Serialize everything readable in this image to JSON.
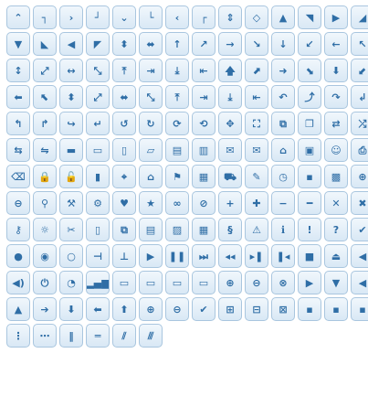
{
  "palette": {
    "tile_top": "#f1f7fc",
    "tile_bottom": "#d9e8f5",
    "border": "#a9c6df",
    "icon": "#2f6ea6"
  },
  "icons": [
    {
      "name": "caret-up-icon",
      "glyph": "⌃"
    },
    {
      "name": "corner-top-right-icon",
      "glyph": "┐"
    },
    {
      "name": "caret-right-icon",
      "glyph": "›"
    },
    {
      "name": "corner-bottom-right-icon",
      "glyph": "┘"
    },
    {
      "name": "caret-down-icon",
      "glyph": "⌄"
    },
    {
      "name": "corner-bottom-left-icon",
      "glyph": "└"
    },
    {
      "name": "caret-left-icon",
      "glyph": "‹"
    },
    {
      "name": "corner-top-left-icon",
      "glyph": "┌"
    },
    {
      "name": "caret-up-down-icon",
      "glyph": "⇕"
    },
    {
      "name": "caret-left-right-icon",
      "glyph": "◇"
    },
    {
      "name": "triangle-up-icon",
      "glyph": "▲"
    },
    {
      "name": "triangle-up-right-icon",
      "glyph": "◥"
    },
    {
      "name": "triangle-right-icon",
      "glyph": "▶"
    },
    {
      "name": "triangle-down-right-icon",
      "glyph": "◢"
    },
    {
      "name": "triangle-down-icon",
      "glyph": "▼"
    },
    {
      "name": "triangle-down-left-icon",
      "glyph": "◣"
    },
    {
      "name": "triangle-left-icon",
      "glyph": "◀"
    },
    {
      "name": "triangle-up-left-icon",
      "glyph": "◤"
    },
    {
      "name": "triangle-up-down-icon",
      "glyph": "⬍"
    },
    {
      "name": "triangle-left-right-icon",
      "glyph": "⬌"
    },
    {
      "name": "arrow-up-thin-icon",
      "glyph": "↑"
    },
    {
      "name": "arrow-up-right-thin-icon",
      "glyph": "↗"
    },
    {
      "name": "arrow-right-thin-icon",
      "glyph": "→"
    },
    {
      "name": "arrow-down-right-thin-icon",
      "glyph": "↘"
    },
    {
      "name": "arrow-down-thin-icon",
      "glyph": "↓"
    },
    {
      "name": "arrow-down-left-thin-icon",
      "glyph": "↙"
    },
    {
      "name": "arrow-left-thin-icon",
      "glyph": "←"
    },
    {
      "name": "arrow-up-left-thin-icon",
      "glyph": "↖"
    },
    {
      "name": "arrow-up-down-thin-icon",
      "glyph": "↕"
    },
    {
      "name": "arrow-diagonal-expand-thin-icon",
      "glyph": "⤢"
    },
    {
      "name": "arrow-left-right-thin-icon",
      "glyph": "↔"
    },
    {
      "name": "arrow-diagonal-collapse-thin-icon",
      "glyph": "⤡"
    },
    {
      "name": "arrow-top-thin-icon",
      "glyph": "⤒"
    },
    {
      "name": "arrow-right-end-thin-icon",
      "glyph": "⇥"
    },
    {
      "name": "arrow-bottom-thin-icon",
      "glyph": "⤓"
    },
    {
      "name": "arrow-left-end-thin-icon",
      "glyph": "⇤"
    },
    {
      "name": "arrow-up-thick-icon",
      "glyph": "🡅"
    },
    {
      "name": "arrow-up-right-thick-icon",
      "glyph": "⬈"
    },
    {
      "name": "arrow-right-thick-icon",
      "glyph": "➜"
    },
    {
      "name": "arrow-down-right-thick-icon",
      "glyph": "⬊"
    },
    {
      "name": "arrow-down-thick-icon",
      "glyph": "⬇"
    },
    {
      "name": "arrow-down-left-thick-icon",
      "glyph": "⬋"
    },
    {
      "name": "arrow-left-thick-icon",
      "glyph": "⬅"
    },
    {
      "name": "arrow-up-left-thick-icon",
      "glyph": "⬉"
    },
    {
      "name": "arrow-up-down-thick-icon",
      "glyph": "⬍"
    },
    {
      "name": "arrow-expand-thick-icon",
      "glyph": "⤢"
    },
    {
      "name": "arrow-left-right-thick-icon",
      "glyph": "⬌"
    },
    {
      "name": "arrow-collapse-thick-icon",
      "glyph": "⤡"
    },
    {
      "name": "arrow-top-thick-icon",
      "glyph": "⤒"
    },
    {
      "name": "arrow-right-end-thick-icon",
      "glyph": "⇥"
    },
    {
      "name": "arrow-bottom-thick-icon",
      "glyph": "⤓"
    },
    {
      "name": "arrow-left-end-thick-icon",
      "glyph": "⇤"
    },
    {
      "name": "return-left-icon",
      "glyph": "↶"
    },
    {
      "name": "return-up-icon",
      "glyph": "⤴"
    },
    {
      "name": "return-right-icon",
      "glyph": "↷"
    },
    {
      "name": "return-down-icon",
      "glyph": "↲"
    },
    {
      "name": "turn-left-icon",
      "glyph": "↰"
    },
    {
      "name": "turn-up-icon",
      "glyph": "↱"
    },
    {
      "name": "turn-right-icon",
      "glyph": "↪"
    },
    {
      "name": "turn-down-icon",
      "glyph": "↵"
    },
    {
      "name": "refresh-icon",
      "glyph": "↺"
    },
    {
      "name": "redo-icon",
      "glyph": "↻"
    },
    {
      "name": "rotate-right-icon",
      "glyph": "⟳"
    },
    {
      "name": "reload-icon",
      "glyph": "⟲"
    },
    {
      "name": "move-icon",
      "glyph": "✥"
    },
    {
      "name": "fullscreen-icon",
      "glyph": "⛶"
    },
    {
      "name": "external-link-icon",
      "glyph": "⧉"
    },
    {
      "name": "new-window-icon",
      "glyph": "❐"
    },
    {
      "name": "sync-icon",
      "glyph": "⇄"
    },
    {
      "name": "shuffle-icon",
      "glyph": "⤮"
    },
    {
      "name": "transfer-icon",
      "glyph": "⇆"
    },
    {
      "name": "transfer-thick-icon",
      "glyph": "⇋"
    },
    {
      "name": "folder-closed-icon",
      "glyph": "▬"
    },
    {
      "name": "folder-open-icon",
      "glyph": "▭"
    },
    {
      "name": "document-icon",
      "glyph": "▯"
    },
    {
      "name": "note-icon",
      "glyph": "▱"
    },
    {
      "name": "document-text-icon",
      "glyph": "▤"
    },
    {
      "name": "newspaper-icon",
      "glyph": "▥"
    },
    {
      "name": "mail-closed-icon",
      "glyph": "✉"
    },
    {
      "name": "mail-open-icon",
      "glyph": "✉"
    },
    {
      "name": "suitcase-icon",
      "glyph": "⌂"
    },
    {
      "name": "comment-icon",
      "glyph": "▣"
    },
    {
      "name": "person-icon",
      "glyph": "☺"
    },
    {
      "name": "print-icon",
      "glyph": "⎙"
    },
    {
      "name": "trash-icon",
      "glyph": "⌫"
    },
    {
      "name": "locked-icon",
      "glyph": "🔒"
    },
    {
      "name": "unlocked-icon",
      "glyph": "🔓"
    },
    {
      "name": "bookmark-icon",
      "glyph": "▮"
    },
    {
      "name": "tag-icon",
      "glyph": "⌖"
    },
    {
      "name": "home-icon",
      "glyph": "⌂"
    },
    {
      "name": "flag-icon",
      "glyph": "⚑"
    },
    {
      "name": "calendar-icon",
      "glyph": "▦"
    },
    {
      "name": "cart-icon",
      "glyph": "⛟"
    },
    {
      "name": "pencil-icon",
      "glyph": "✎"
    },
    {
      "name": "clock-icon",
      "glyph": "◷"
    },
    {
      "name": "disk-icon",
      "glyph": "▪"
    },
    {
      "name": "calculator-icon",
      "glyph": "▩"
    },
    {
      "name": "zoom-in-icon",
      "glyph": "⊕"
    },
    {
      "name": "zoom-out-icon",
      "glyph": "⊖"
    },
    {
      "name": "search-icon",
      "glyph": "⚲"
    },
    {
      "name": "wrench-icon",
      "glyph": "⚒"
    },
    {
      "name": "gear-icon",
      "glyph": "⚙"
    },
    {
      "name": "heart-icon",
      "glyph": "♥"
    },
    {
      "name": "star-icon",
      "glyph": "★"
    },
    {
      "name": "link-icon",
      "glyph": "∞"
    },
    {
      "name": "cancel-icon",
      "glyph": "⊘"
    },
    {
      "name": "plus-icon",
      "glyph": "+"
    },
    {
      "name": "plus-thick-icon",
      "glyph": "✚"
    },
    {
      "name": "minus-icon",
      "glyph": "−"
    },
    {
      "name": "minus-thick-icon",
      "glyph": "━"
    },
    {
      "name": "close-icon",
      "glyph": "✕"
    },
    {
      "name": "close-thick-icon",
      "glyph": "✖"
    },
    {
      "name": "key-icon",
      "glyph": "⚷"
    },
    {
      "name": "lightbulb-icon",
      "glyph": "☼"
    },
    {
      "name": "scissors-icon",
      "glyph": "✂"
    },
    {
      "name": "clipboard-icon",
      "glyph": "▯"
    },
    {
      "name": "copy-icon",
      "glyph": "⧉"
    },
    {
      "name": "contact-icon",
      "glyph": "▤"
    },
    {
      "name": "image-icon",
      "glyph": "▨"
    },
    {
      "name": "video-icon",
      "glyph": "▦"
    },
    {
      "name": "script-icon",
      "glyph": "§"
    },
    {
      "name": "alert-icon",
      "glyph": "⚠"
    },
    {
      "name": "info-icon",
      "glyph": "ℹ"
    },
    {
      "name": "notice-icon",
      "glyph": "!"
    },
    {
      "name": "help-icon",
      "glyph": "?"
    },
    {
      "name": "check-icon",
      "glyph": "✔"
    },
    {
      "name": "bullet-icon",
      "glyph": "●"
    },
    {
      "name": "radio-on-icon",
      "glyph": "◉"
    },
    {
      "name": "radio-off-icon",
      "glyph": "○"
    },
    {
      "name": "pin-west-icon",
      "glyph": "⊣"
    },
    {
      "name": "pin-south-icon",
      "glyph": "⊥"
    },
    {
      "name": "play-icon",
      "glyph": "▶"
    },
    {
      "name": "pause-icon",
      "glyph": "❚❚"
    },
    {
      "name": "seek-next-icon",
      "glyph": "⏭"
    },
    {
      "name": "seek-prev-icon",
      "glyph": "◂◂"
    },
    {
      "name": "seek-end-icon",
      "glyph": "▸❚"
    },
    {
      "name": "seek-start-icon",
      "glyph": "❚◂"
    },
    {
      "name": "stop-icon",
      "glyph": "■"
    },
    {
      "name": "eject-icon",
      "glyph": "⏏"
    },
    {
      "name": "volume-off-icon",
      "glyph": "◀"
    },
    {
      "name": "volume-on-icon",
      "glyph": "◀)"
    },
    {
      "name": "power-icon",
      "glyph": "⏻"
    },
    {
      "name": "signal-diag-icon",
      "glyph": "◔"
    },
    {
      "name": "signal-icon",
      "glyph": "▂▄▆"
    },
    {
      "name": "battery-0-icon",
      "glyph": "▭"
    },
    {
      "name": "battery-1-icon",
      "glyph": "▭"
    },
    {
      "name": "battery-2-icon",
      "glyph": "▭"
    },
    {
      "name": "battery-3-icon",
      "glyph": "▭"
    },
    {
      "name": "circle-plus-icon",
      "glyph": "⊕"
    },
    {
      "name": "circle-minus-icon",
      "glyph": "⊖"
    },
    {
      "name": "circle-close-icon",
      "glyph": "⊗"
    },
    {
      "name": "circle-triangle-east-icon",
      "glyph": "▶"
    },
    {
      "name": "circle-triangle-south-icon",
      "glyph": "▼"
    },
    {
      "name": "circle-triangle-west-icon",
      "glyph": "◀"
    },
    {
      "name": "circle-triangle-north-icon",
      "glyph": "▲"
    },
    {
      "name": "circle-arrow-east-icon",
      "glyph": "➔"
    },
    {
      "name": "circle-arrow-south-icon",
      "glyph": "⬇"
    },
    {
      "name": "circle-arrow-west-icon",
      "glyph": "⬅"
    },
    {
      "name": "circle-arrow-north-icon",
      "glyph": "⬆"
    },
    {
      "name": "circle-zoom-in-icon",
      "glyph": "⊕"
    },
    {
      "name": "circle-zoom-out-icon",
      "glyph": "⊖"
    },
    {
      "name": "circle-check-icon",
      "glyph": "✔"
    },
    {
      "name": "circlesmall-plus-icon",
      "glyph": "⊞"
    },
    {
      "name": "circlesmall-minus-icon",
      "glyph": "⊟"
    },
    {
      "name": "circlesmall-close-icon",
      "glyph": "⊠"
    },
    {
      "name": "squaresmall-plus-icon",
      "glyph": "▪"
    },
    {
      "name": "squaresmall-minus-icon",
      "glyph": "▪"
    },
    {
      "name": "squaresmall-close-icon",
      "glyph": "▪"
    },
    {
      "name": "grip-dotted-vertical-icon",
      "glyph": "⋮"
    },
    {
      "name": "grip-dotted-horizontal-icon",
      "glyph": "⋯"
    },
    {
      "name": "grip-solid-vertical-icon",
      "glyph": "‖"
    },
    {
      "name": "grip-solid-horizontal-icon",
      "glyph": "═"
    },
    {
      "name": "grip-diagonal-small-icon",
      "glyph": "⫽"
    },
    {
      "name": "grip-diagonal-large-icon",
      "glyph": "⫻"
    }
  ]
}
